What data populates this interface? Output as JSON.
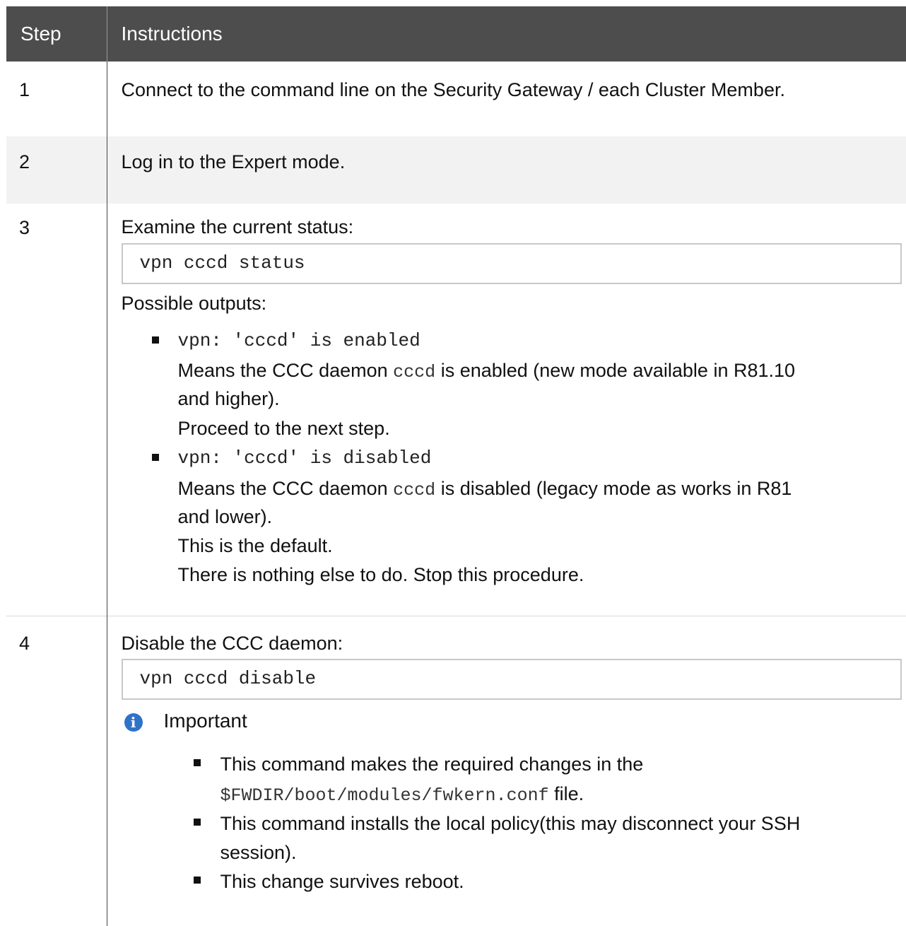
{
  "headers": {
    "step": "Step",
    "instructions": "Instructions"
  },
  "rows": [
    {
      "step": "1",
      "text": "Connect to the command line on the Security Gateway / each Cluster Member."
    },
    {
      "step": "2",
      "text": "Log in to the Expert mode."
    },
    {
      "step": "3",
      "intro": "Examine the current status:",
      "command": "vpn cccd status",
      "outputs_label": "Possible outputs:",
      "outputs": [
        {
          "code": "vpn: 'cccd' is enabled",
          "desc_pre": "Means the CCC daemon",
          "desc_code": "cccd",
          "desc_post_line1": "is enabled (new mode available in R81.10",
          "desc_post_line2": "and higher).",
          "extra": [
            "Proceed to the next step."
          ]
        },
        {
          "code": "vpn: 'cccd' is disabled",
          "desc_pre": "Means the CCC daemon",
          "desc_code": "cccd",
          "desc_post_line1": "is disabled (legacy mode as works in R81",
          "desc_post_line2": "and lower).",
          "extra": [
            "This is the default.",
            "There is nothing else to do. Stop this procedure."
          ]
        }
      ]
    },
    {
      "step": "4",
      "intro": "Disable the CCC daemon:",
      "command": "vpn cccd disable",
      "note_title": "Important",
      "note_icon": "info-icon",
      "notes": {
        "n1_line1": "This command makes the required changes in the",
        "n1_code": "$FWDIR/boot/modules/fwkern.conf",
        "n1_post": "file.",
        "n2_line1": "This command installs the local policy(this may disconnect your SSH",
        "n2_line2": "session).",
        "n3": "This change survives reboot."
      }
    }
  ],
  "colors": {
    "header_bg": "#4d4d4d",
    "shaded_row": "#f2f2f2",
    "info_icon": "#2f73c9"
  }
}
